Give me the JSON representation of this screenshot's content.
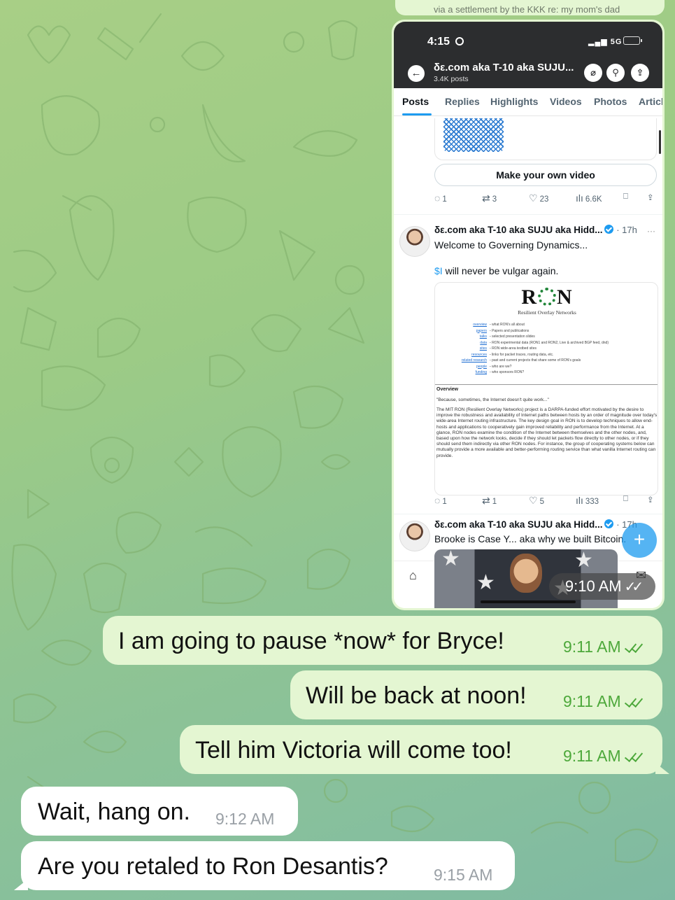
{
  "chat": {
    "top_cut_text": "via a settlement by the KKK re: my mom's dad",
    "screenshot_time": "9:10 AM",
    "messages": [
      {
        "direction": "out",
        "text": "I am going to pause *now* for Bryce!",
        "time": "9:11 AM",
        "read": true
      },
      {
        "direction": "out",
        "text": "Will be back at noon!",
        "time": "9:11 AM",
        "read": true
      },
      {
        "direction": "out",
        "text": "Tell him Victoria will come too!",
        "time": "9:11 AM",
        "read": true
      },
      {
        "direction": "in",
        "text": "Wait, hang on.",
        "time": "9:12 AM"
      },
      {
        "direction": "in",
        "text": "Are you retaled to Ron Desantis?",
        "time": "9:15 AM"
      }
    ]
  },
  "phone": {
    "status_time": "4:15",
    "network": "5G",
    "profile_name": "δε.com aka T-10 aka SUJU...",
    "post_count": "3.4K posts",
    "tabs": [
      "Posts",
      "Replies",
      "Highlights",
      "Videos",
      "Photos",
      "Articl"
    ],
    "make_video_label": "Make your own video",
    "post1_actions": {
      "replies": "1",
      "reposts": "3",
      "likes": "23",
      "views": "6.6K"
    },
    "post2": {
      "name": "δε.com aka T-10 aka SUJU aka Hidd...",
      "time": "· 17h",
      "line1": "Welcome to Governing Dynamics...",
      "cashtag": "$I",
      "line2": " will never be vulgar again.",
      "actions": {
        "replies": "1",
        "reposts": "1",
        "likes": "5",
        "views": "333"
      }
    },
    "web_card": {
      "logo_left": "R",
      "logo_right": "N",
      "subtitle": "Resilient Overlay Networks",
      "links": [
        {
          "k": "overview",
          "v": "what RON's all about"
        },
        {
          "k": "papers",
          "v": "Papers and publications"
        },
        {
          "k": "talks",
          "v": "selected presentation slides"
        },
        {
          "k": "data",
          "v": "RON experimental data (RON1 and RON2, Live & archived BGP feed, dnd)"
        },
        {
          "k": "sites",
          "v": "RON wide-area testbed sites"
        },
        {
          "k": "resources",
          "v": "links for packet traces, routing data, etc."
        },
        {
          "k": "related research",
          "v": "past and current projects that share some of RON's goals"
        },
        {
          "k": "people",
          "v": "who are we?"
        },
        {
          "k": "funding",
          "v": "who sponsors RON?"
        }
      ],
      "overview_heading": "Overview",
      "quote": "\"Because, sometimes, the Internet doesn't quite work...\"",
      "body": "The MIT RON (Resilient Overlay Networks) project is a DARPA-funded effort motivated by the desire to improve the robustness and availability of Internet paths between hosts by an order of magnitude over today's wide-area Internet routing infrastructure. The key design goal in RON is to develop techniques to allow end-hosts and applications to cooperatively gain improved reliability and performance from the Internet. At a glance, RON nodes examine the condition of the Internet between themselves and the other nodes, and, based upon how the network looks, decide if they should let packets flow directly to other nodes, or if they should send them indirectly via other RON nodes. For instance, the group of cooperating systems below can mutually provide a more available and better-performing routing service than what vanilla Internet routing can provide."
    },
    "post3": {
      "name": "δε.com aka T-10 aka SUJU aka Hidd...",
      "time": "· 17h",
      "line1": "Brooke is Case Y... aka why we built Bitcoin."
    },
    "fab_label": "+"
  }
}
